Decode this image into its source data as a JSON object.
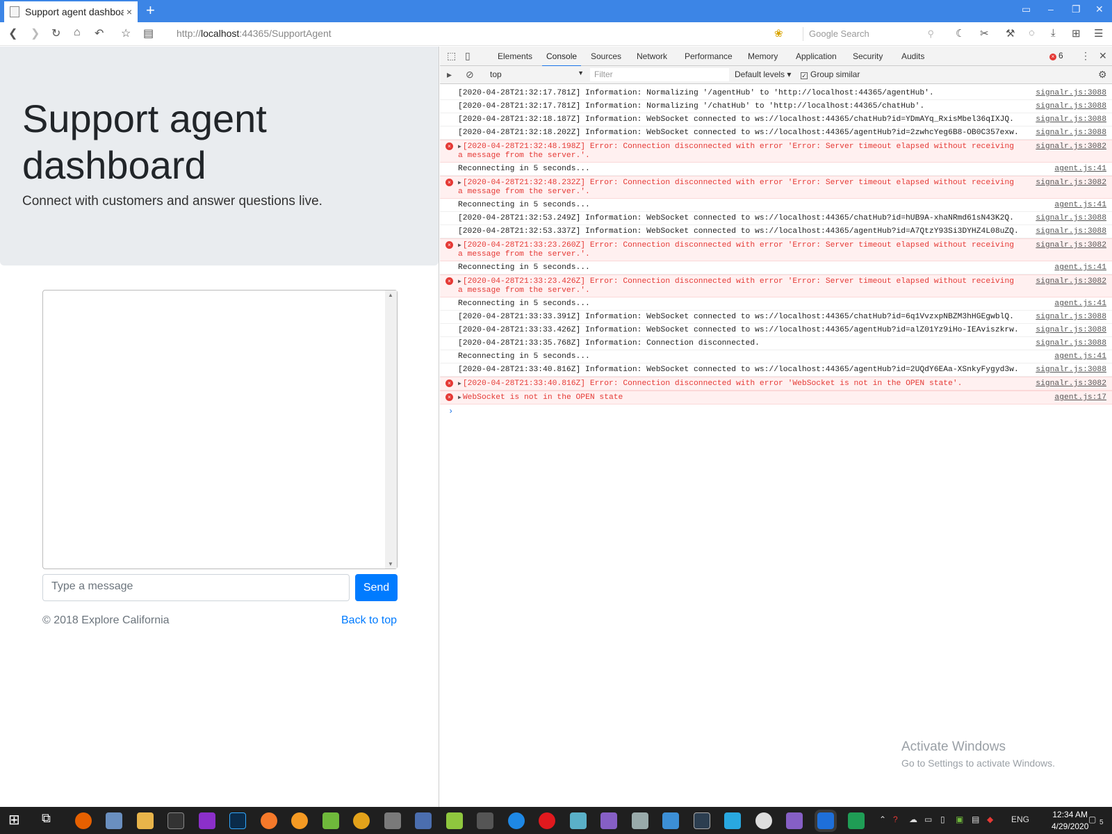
{
  "browser": {
    "tab_title": "Support agent dashboard",
    "tab_close": "×",
    "new_tab": "+",
    "url_prefix": "http://",
    "url_host": "localhost",
    "url_rest": ":44365/SupportAgent",
    "search_placeholder": "Google Search"
  },
  "page": {
    "heading": "Support agent dashboard",
    "lead": "Connect with customers and answer questions live.",
    "message_placeholder": "Type a message",
    "send_label": "Send",
    "copyright": "© 2018 Explore California",
    "back_to_top": "Back to top"
  },
  "devtools": {
    "tabs": [
      "Elements",
      "Console",
      "Sources",
      "Network",
      "Performance",
      "Memory",
      "Application",
      "Security",
      "Audits"
    ],
    "active_tab": "Console",
    "error_count": "6",
    "context": "top",
    "filter_placeholder": "Filter",
    "levels": "Default levels",
    "group_similar": "Group similar",
    "entries": [
      {
        "type": "info",
        "text": "[2020-04-28T21:32:17.781Z] Information: Normalizing '/agentHub' to 'http://localhost:44365/agentHub'.",
        "src": "signalr.js:3088"
      },
      {
        "type": "info",
        "text": "[2020-04-28T21:32:17.781Z] Information: Normalizing '/chatHub' to 'http://localhost:44365/chatHub'.",
        "src": "signalr.js:3088"
      },
      {
        "type": "info",
        "text": "[2020-04-28T21:32:18.187Z] Information: WebSocket connected to ws://localhost:44365/chatHub?id=YDmAYq_RxisMbel36qIXJQ.",
        "src": "signalr.js:3088"
      },
      {
        "type": "info",
        "text": "[2020-04-28T21:32:18.202Z] Information: WebSocket connected to ws://localhost:44365/agentHub?id=2zwhcYeg6B8-OB0C357exw.",
        "src": "signalr.js:3088"
      },
      {
        "type": "error",
        "text": "[2020-04-28T21:32:48.198Z] Error: Connection disconnected with error 'Error: Server timeout elapsed without receiving a message from the server.'.",
        "src": "signalr.js:3082"
      },
      {
        "type": "info",
        "text": "Reconnecting in 5 seconds...",
        "src": "agent.js:41"
      },
      {
        "type": "error",
        "text": "[2020-04-28T21:32:48.232Z] Error: Connection disconnected with error 'Error: Server timeout elapsed without receiving a message from the server.'.",
        "src": "signalr.js:3082"
      },
      {
        "type": "info",
        "text": "Reconnecting in 5 seconds...",
        "src": "agent.js:41"
      },
      {
        "type": "info",
        "text": "[2020-04-28T21:32:53.249Z] Information: WebSocket connected to ws://localhost:44365/chatHub?id=hUB9A-xhaNRmd61sN43K2Q.",
        "src": "signalr.js:3088"
      },
      {
        "type": "info",
        "text": "[2020-04-28T21:32:53.337Z] Information: WebSocket connected to ws://localhost:44365/agentHub?id=A7QtzY93Si3DYHZ4L08uZQ.",
        "src": "signalr.js:3088"
      },
      {
        "type": "error",
        "text": "[2020-04-28T21:33:23.260Z] Error: Connection disconnected with error 'Error: Server timeout elapsed without receiving a message from the server.'.",
        "src": "signalr.js:3082"
      },
      {
        "type": "info",
        "text": "Reconnecting in 5 seconds...",
        "src": "agent.js:41"
      },
      {
        "type": "error",
        "text": "[2020-04-28T21:33:23.426Z] Error: Connection disconnected with error 'Error: Server timeout elapsed without receiving a message from the server.'.",
        "src": "signalr.js:3082"
      },
      {
        "type": "info",
        "text": "Reconnecting in 5 seconds...",
        "src": "agent.js:41"
      },
      {
        "type": "info",
        "text": "[2020-04-28T21:33:33.391Z] Information: WebSocket connected to ws://localhost:44365/chatHub?id=6q1VvzxpNBZM3hHGEgwblQ.",
        "src": "signalr.js:3088"
      },
      {
        "type": "info",
        "text": "[2020-04-28T21:33:33.426Z] Information: WebSocket connected to ws://localhost:44365/agentHub?id=alZ01Yz9iHo-IEAviszkrw.",
        "src": "signalr.js:3088"
      },
      {
        "type": "info",
        "text": "[2020-04-28T21:33:35.768Z] Information: Connection disconnected.",
        "src": "signalr.js:3088"
      },
      {
        "type": "info",
        "text": "Reconnecting in 5 seconds...",
        "src": "agent.js:41"
      },
      {
        "type": "info",
        "text": "[2020-04-28T21:33:40.816Z] Information: WebSocket connected to ws://localhost:44365/agentHub?id=2UQdY6EAa-XSnkyFygyd3w.",
        "src": "signalr.js:3088"
      },
      {
        "type": "error",
        "text": "[2020-04-28T21:33:40.816Z] Error: Connection disconnected with error 'WebSocket is not in the OPEN state'.",
        "src": "signalr.js:3082"
      },
      {
        "type": "error",
        "text": "WebSocket is not in the OPEN state",
        "src": "agent.js:17"
      }
    ]
  },
  "watermark": {
    "line1": "Activate Windows",
    "line2": "Go to Settings to activate Windows."
  },
  "taskbar": {
    "language": "ENG",
    "time": "12:34 AM",
    "date": "4/29/2020",
    "notifications": "5"
  }
}
